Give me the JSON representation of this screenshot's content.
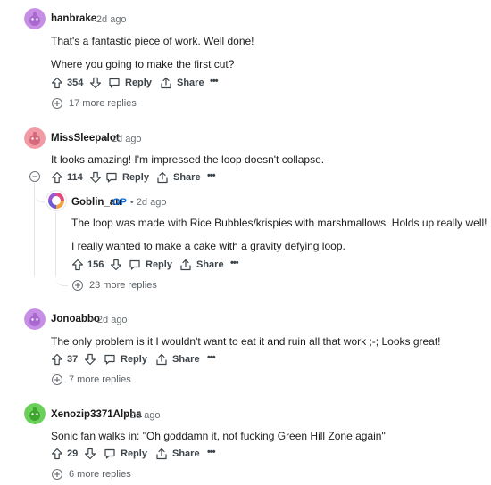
{
  "colors": {
    "avatar_purple": "#c78ee6",
    "avatar_pink": "#f29aa6",
    "avatar_green": "#6bd05a",
    "op_blue": "#0a66d6"
  },
  "actions": {
    "reply": "Reply",
    "share": "Share",
    "more": "•••"
  },
  "comments": [
    {
      "user": "hanbrake",
      "time": "• 2d ago",
      "lines": [
        "That's a fantastic piece of work. Well done!",
        "Where you going to make the first cut?"
      ],
      "votes": "354",
      "more_replies": "17 more replies"
    },
    {
      "user": "MissSleepalot",
      "time": "• 2d ago",
      "lines": [
        "It looks amazing! I'm impressed the loop doesn't collapse."
      ],
      "votes": "114",
      "reply": {
        "user": "Goblin_au",
        "op_badge": "OP",
        "time": "• 2d ago",
        "lines": [
          "The loop was made with Rice Bubbles/krispies with marshmallows. Holds up really well!",
          "I really wanted to make a cake with a gravity defying loop."
        ],
        "votes": "156",
        "more_replies": "23 more replies"
      }
    },
    {
      "user": "Jonoabbo",
      "time": "• 2d ago",
      "lines": [
        "The only problem is it I wouldn't want to eat it and ruin all that work ;-; Looks great!"
      ],
      "votes": "37",
      "more_replies": "7 more replies"
    },
    {
      "user": "Xenozip3371Alpha",
      "time": "• 2d ago",
      "lines": [
        "Sonic fan walks in: \"Oh goddamn it, not fucking Green Hill Zone again\""
      ],
      "votes": "29",
      "more_replies": "6 more replies"
    }
  ]
}
